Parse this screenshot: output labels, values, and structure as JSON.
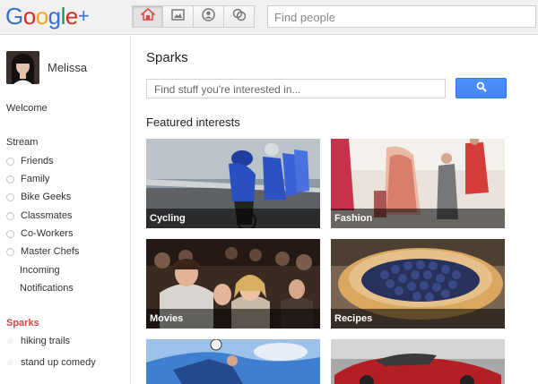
{
  "app": {
    "logo_text": "Google",
    "logo_plus": "+"
  },
  "topbar": {
    "nav_icons": [
      "home-icon",
      "photos-icon",
      "profile-icon",
      "circles-icon"
    ],
    "search_placeholder": "Find people"
  },
  "sidebar": {
    "user_name": "Melissa",
    "welcome": "Welcome",
    "stream_label": "Stream",
    "circles": [
      {
        "label": "Friends"
      },
      {
        "label": "Family"
      },
      {
        "label": "Bike Geeks"
      },
      {
        "label": "Classmates"
      },
      {
        "label": "Co-Workers"
      },
      {
        "label": "Master Chefs"
      }
    ],
    "incoming": "Incoming",
    "notifications": "Notifications",
    "sparks_label": "Sparks",
    "sparks": [
      {
        "label": "hiking trails"
      },
      {
        "label": "stand up comedy"
      }
    ]
  },
  "main": {
    "title": "Sparks",
    "search_placeholder": "Find stuff you're interested in...",
    "featured_title": "Featured interests",
    "tiles": [
      {
        "label": "Cycling"
      },
      {
        "label": "Fashion"
      },
      {
        "label": "Movies"
      },
      {
        "label": "Recipes"
      },
      {
        "label": ""
      },
      {
        "label": ""
      }
    ]
  },
  "colors": {
    "accent_blue": "#4d90fe",
    "sparks_red": "#dd4b39",
    "google_blue": "#3366cc",
    "google_red": "#d62d20",
    "google_yellow": "#ffa700",
    "google_green": "#008744"
  }
}
